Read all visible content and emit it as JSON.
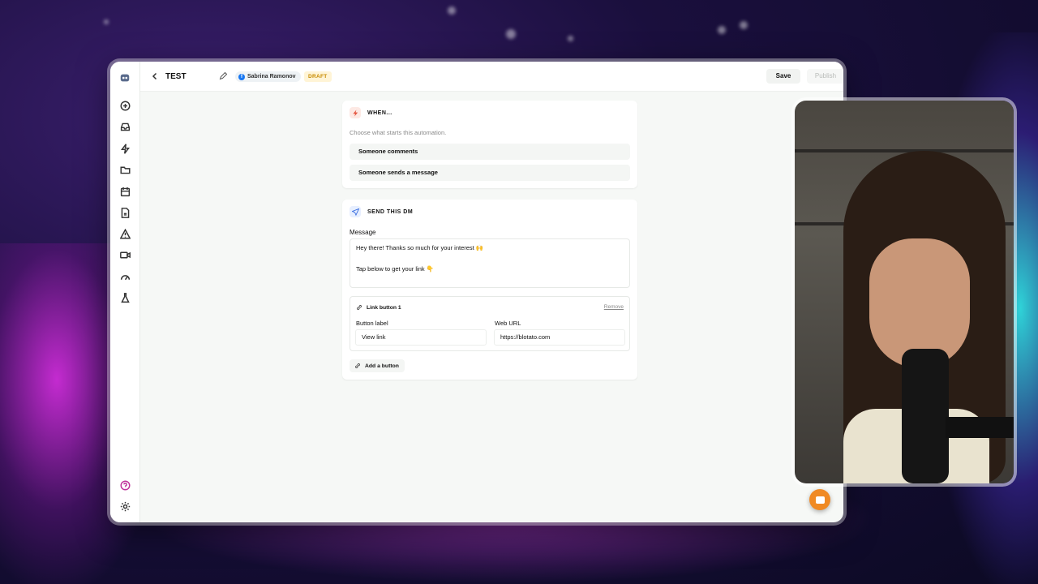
{
  "topbar": {
    "title": "TEST",
    "account_name": "Sabrina Ramonov",
    "status_badge": "DRAFT",
    "save_label": "Save",
    "publish_label": "Publish",
    "more_label": "···"
  },
  "sidebar": {
    "icons": [
      "app-logo-icon",
      "plus-circle-icon",
      "inbox-icon",
      "bolt-icon",
      "folder-icon",
      "calendar-icon",
      "file-icon",
      "warning-icon",
      "video-icon",
      "gauge-icon",
      "flask-icon",
      "help-icon",
      "gear-icon"
    ]
  },
  "trigger_card": {
    "heading": "WHEN...",
    "hint": "Choose what starts this automation.",
    "options": [
      "Someone comments",
      "Someone sends a message"
    ]
  },
  "dm_card": {
    "heading": "SEND THIS DM",
    "message_label": "Message",
    "message_line1": "Hey there! Thanks so much for your interest 🙌",
    "message_line2": "Tap below to get your link 👇",
    "link_button": {
      "title": "Link button 1",
      "remove_label": "Remove",
      "button_label_label": "Button label",
      "button_label_value": "View link",
      "url_label": "Web URL",
      "url_value": "https://blotato.com"
    },
    "add_button_label": "Add a button"
  },
  "colors": {
    "accent_orange": "#f08a24",
    "trigger_badge": "#e5533d",
    "dm_badge": "#3b6fe0",
    "draft_text": "#c78a00"
  }
}
